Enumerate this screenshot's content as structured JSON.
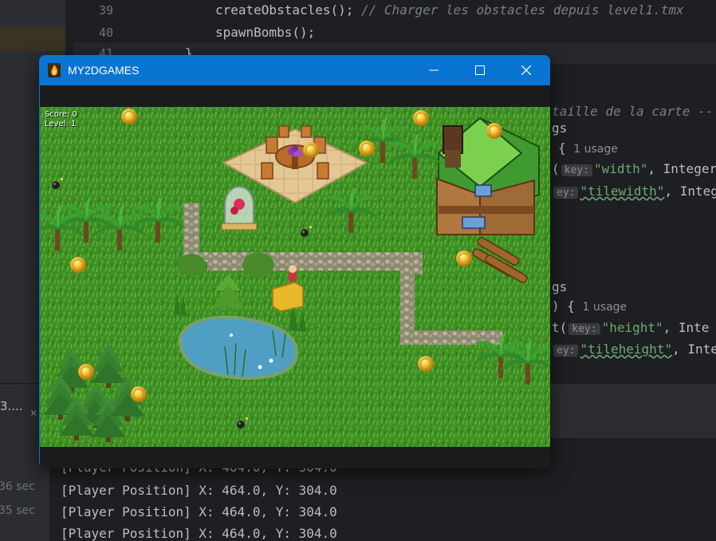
{
  "editor": {
    "lines": [
      {
        "num": "39",
        "code": "createObstacles();",
        "comment": " // Charger les obstacles depuis level1.tmx"
      },
      {
        "num": "40",
        "code": "spawnBombs();"
      },
      {
        "num": "41",
        "code": "}"
      }
    ],
    "fragments": {
      "map_size_comment": "taille de la carte --",
      "gs1": "gs",
      "brace1": "{",
      "usage1": "1 usage",
      "paren1": "(",
      "key_hint": "key:",
      "str_width": "\"width\"",
      "integer1": ", Integer",
      "key_hint_short": "ey:",
      "str_tilewidth": "\"tilewidth\"",
      "integer2": ", Intege",
      "gs2": "gs",
      "paren_brace2": ") {",
      "usage2": "1 usage",
      "t_paren": "t(",
      "str_height": "\"height\"",
      "integer3": ", Inte",
      "str_tileheight": "\"tileheight\"",
      "integer4": ", Inte"
    }
  },
  "panel": {
    "tab_label": "3....",
    "tab_close": "×"
  },
  "console": {
    "times": [
      "36 sec",
      "35 sec"
    ],
    "logs": [
      "[Player Position] X: 464.0, Y: 304.0",
      "[Player Position] X: 464.0, Y: 304.0",
      "[Player Position] X: 464.0, Y: 304.0",
      "[Player Position] X: 464.0, Y: 304.0"
    ]
  },
  "game_window": {
    "title": "MY2DGAMES",
    "icon": "fire-icon",
    "controls": {
      "minimize": "minimize-icon",
      "maximize": "maximize-icon",
      "close": "close-icon"
    },
    "hud": {
      "score": "Score: 0",
      "level": "Level: 1"
    }
  },
  "colors": {
    "ide_bg": "#1e1f22",
    "titlebar": "#0a74d2",
    "grass": "#3f8f25",
    "path": "#a9a08a",
    "water": "#4f9fc5"
  }
}
